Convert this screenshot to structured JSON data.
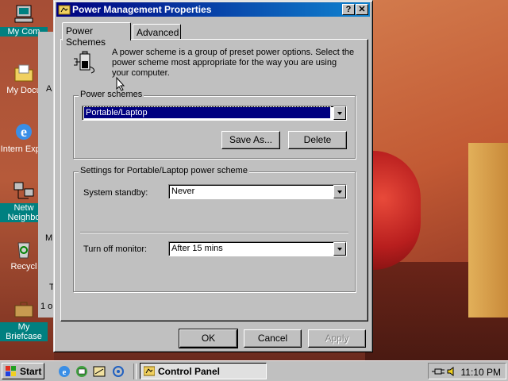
{
  "window": {
    "title": "Power Management Properties",
    "help_btn": "?",
    "close_btn": "✕"
  },
  "tabs": [
    {
      "label": "Power Schemes",
      "active": true
    },
    {
      "label": "Advanced",
      "active": false
    }
  ],
  "intro_text": "A power scheme is a group of preset power options. Select the power scheme most appropriate for the way you are using your computer.",
  "power_schemes": {
    "group_label": "Power schemes",
    "selected": "Portable/Laptop",
    "save_as_label": "Save As...",
    "delete_label": "Delete"
  },
  "settings": {
    "group_label": "Settings for Portable/Laptop power scheme",
    "standby_label": "System standby:",
    "standby_value": "Never",
    "monitor_label": "Turn off monitor:",
    "monitor_value": "After 15 mins"
  },
  "buttons": {
    "ok": "OK",
    "cancel": "Cancel",
    "apply": "Apply"
  },
  "desktop_icons": [
    {
      "label": "My Com",
      "icon": "my-computer-icon"
    },
    {
      "label": "My Docu",
      "icon": "my-documents-icon"
    },
    {
      "label": "Intern Explo",
      "icon": "internet-explorer-icon"
    },
    {
      "label": "Netw Neighbo",
      "icon": "network-neighborhood-icon"
    },
    {
      "label": "Recycl",
      "icon": "recycle-bin-icon"
    },
    {
      "label": "My Briefcase",
      "icon": "briefcase-icon"
    }
  ],
  "background_window": {
    "fragments": [
      "A",
      "M",
      "T",
      "1 o"
    ]
  },
  "taskbar": {
    "start_label": "Start",
    "task_label": "Control Panel",
    "clock": "11:10 PM"
  }
}
